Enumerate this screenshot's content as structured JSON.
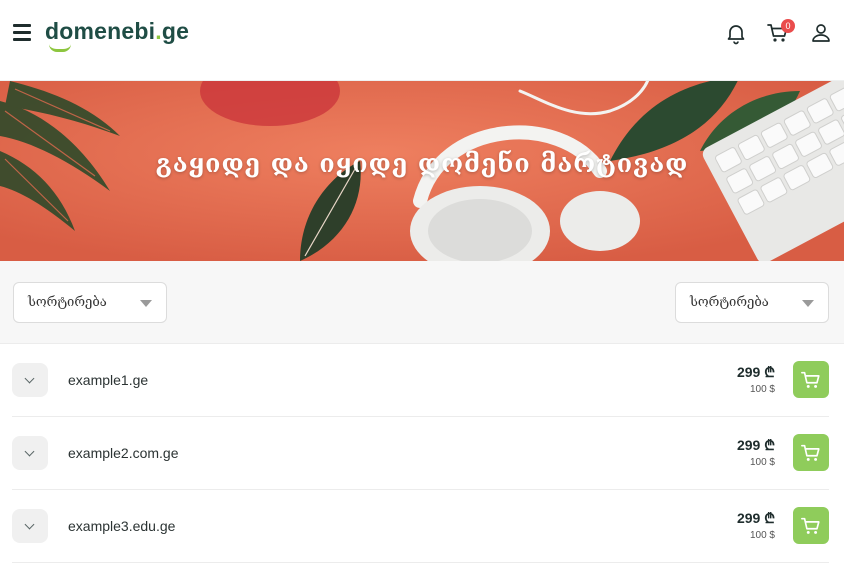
{
  "header": {
    "logo_main": "domenebi",
    "logo_dot": ".",
    "logo_tld": "ge",
    "cart_count": "0"
  },
  "icons": {
    "menu": "hamburger-menu-icon",
    "notifications": "bell-icon",
    "cart": "shopping-cart-icon",
    "account": "user-icon",
    "expand": "chevron-down-icon",
    "add_to_cart": "cart-icon"
  },
  "colors": {
    "brand_dark": "#1f4d45",
    "brand_green": "#8dc63f",
    "buy_button": "#8fcc5b",
    "badge": "#ea4c4c",
    "hero_bg": "#e06a4e"
  },
  "hero": {
    "title": "გაყიდე და იყიდე დომენი მარტივად"
  },
  "filters": {
    "left_sort_label": "სორტირება",
    "right_sort_label": "სორტირება"
  },
  "domains": [
    {
      "name": "example1.ge",
      "price_gel": "299 ₾",
      "price_usd": "100 $"
    },
    {
      "name": "example2.com.ge",
      "price_gel": "299 ₾",
      "price_usd": "100 $"
    },
    {
      "name": "example3.edu.ge",
      "price_gel": "299 ₾",
      "price_usd": "100 $"
    }
  ]
}
